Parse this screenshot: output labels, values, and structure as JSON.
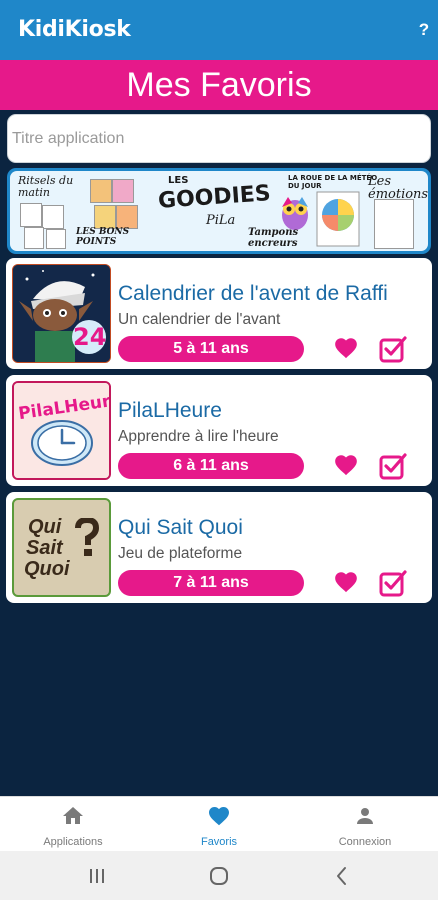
{
  "app": {
    "title": "KidiKiosk",
    "help_label": "?"
  },
  "page": {
    "title": "Mes Favoris"
  },
  "search": {
    "placeholder": "Titre application",
    "value": ""
  },
  "banner": {
    "left_title": "Ritsels du matin",
    "bons_points": "LES BONS POINTS",
    "goodies_les": "LES",
    "goodies": "GOODIES",
    "brand": "PiLa",
    "tampons": "Tampons encreurs",
    "roue_title": "LA ROUE DE LA MÉTÉO DU JOUR",
    "emotions": "Les émotions"
  },
  "favorites": [
    {
      "title": "Calendrier de l'avent de Raffi",
      "subtitle": "Un calendrier de l'avant",
      "age": "5 à 11 ans",
      "thumb_text": "24"
    },
    {
      "title": "PilaLHeure",
      "subtitle": "Apprendre à lire l'heure",
      "age": "6 à 11 ans",
      "thumb_text": "PilaLHeure"
    },
    {
      "title": "Qui Sait Quoi",
      "subtitle": "Jeu de plateforme",
      "age": "7 à 11 ans",
      "thumb_text_1": "Qui",
      "thumb_text_2": "Sait",
      "thumb_text_3": "Quoi"
    }
  ],
  "bottom_nav": [
    {
      "label": "Applications",
      "icon": "home-icon",
      "active": false
    },
    {
      "label": "Favoris",
      "icon": "heart-icon",
      "active": true
    },
    {
      "label": "Connexion",
      "icon": "person-icon",
      "active": false
    }
  ],
  "colors": {
    "primary_blue": "#1f87c9",
    "accent_pink": "#e6198a",
    "background_navy": "#0b2440",
    "title_blue": "#1b6aa5"
  }
}
